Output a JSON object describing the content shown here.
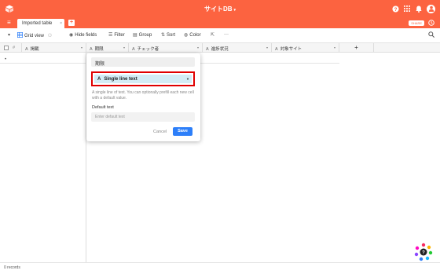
{
  "app": {
    "title": "サイトDB",
    "title_caret": "▾",
    "share_label": "SHARE",
    "top_icons": [
      "help-icon",
      "apps-icon",
      "notification-icon",
      "user-avatar"
    ]
  },
  "tabs": [
    {
      "label": "Imported table",
      "close": "×"
    }
  ],
  "add_tab": "+",
  "toolbar": {
    "view_label": "Grid view",
    "hide_fields": "Hide fields",
    "filter": "Filter",
    "group": "Group",
    "sort": "Sort",
    "color": "Color",
    "more": "···"
  },
  "columns": [
    {
      "label": "掲載",
      "icon": "A"
    },
    {
      "label": "期限",
      "icon": "A"
    },
    {
      "label": "チェック者",
      "icon": "A"
    },
    {
      "label": "進捗状況",
      "icon": "A"
    },
    {
      "label": "対象サイト",
      "icon": "A"
    }
  ],
  "add_column": "+",
  "row_marker": "•",
  "popup": {
    "field_name": "期限",
    "field_type": "Single line text",
    "field_type_icon": "A",
    "description": "A single line of text. You can optionally prefill each new cell with a default value.",
    "default_label": "Default text",
    "default_placeholder": "Enter default text",
    "cancel": "Cancel",
    "save": "Save"
  },
  "footer": {
    "records": "0 records"
  },
  "colors": {
    "brand": "#fc6340",
    "accent": "#2d7ff9",
    "highlight": "#e00000"
  }
}
